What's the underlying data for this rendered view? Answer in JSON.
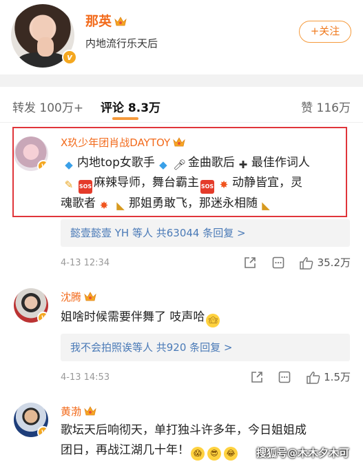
{
  "profile": {
    "name": "那英",
    "description": "内地流行乐天后",
    "follow_label": "+关注"
  },
  "tabs": {
    "repost": "转发 100万+",
    "comment": "评论 8.3万",
    "like": "赞 116万"
  },
  "comments": [
    {
      "name": "X玖少年团肖战DAYTOY",
      "line1": "内地top女歌手",
      "line1b": "金曲歌后",
      "line1c": "最佳作词人",
      "line2": "麻辣导师，舞台霸主",
      "line2b": "动静皆宜，灵",
      "line3": "魂歌者",
      "line3b": "那姐勇敢飞，那迷永相随",
      "replies": "懿壹懿壹 YH 等人  共63044 条回复 >",
      "time": "4-13 12:34",
      "likes": "35.2万"
    },
    {
      "name": "沈腾",
      "text": "姐啥时候需要伴舞了 吱声哈",
      "replies": "我不会拍照诶等人  共920 条回复 >",
      "time": "4-13 14:53",
      "likes": "1.5万"
    },
    {
      "name": "黄渤",
      "line1": "歌坛天后响彻天，单打独斗许多年，今日姐姐成",
      "line2": "团日，再战江湖几十年！"
    }
  ],
  "watermark": "搜狐号@木木夕木可",
  "colors": {
    "accent": "#f26a1b",
    "link": "#4a7ab7",
    "highlight": "#e0353a"
  }
}
